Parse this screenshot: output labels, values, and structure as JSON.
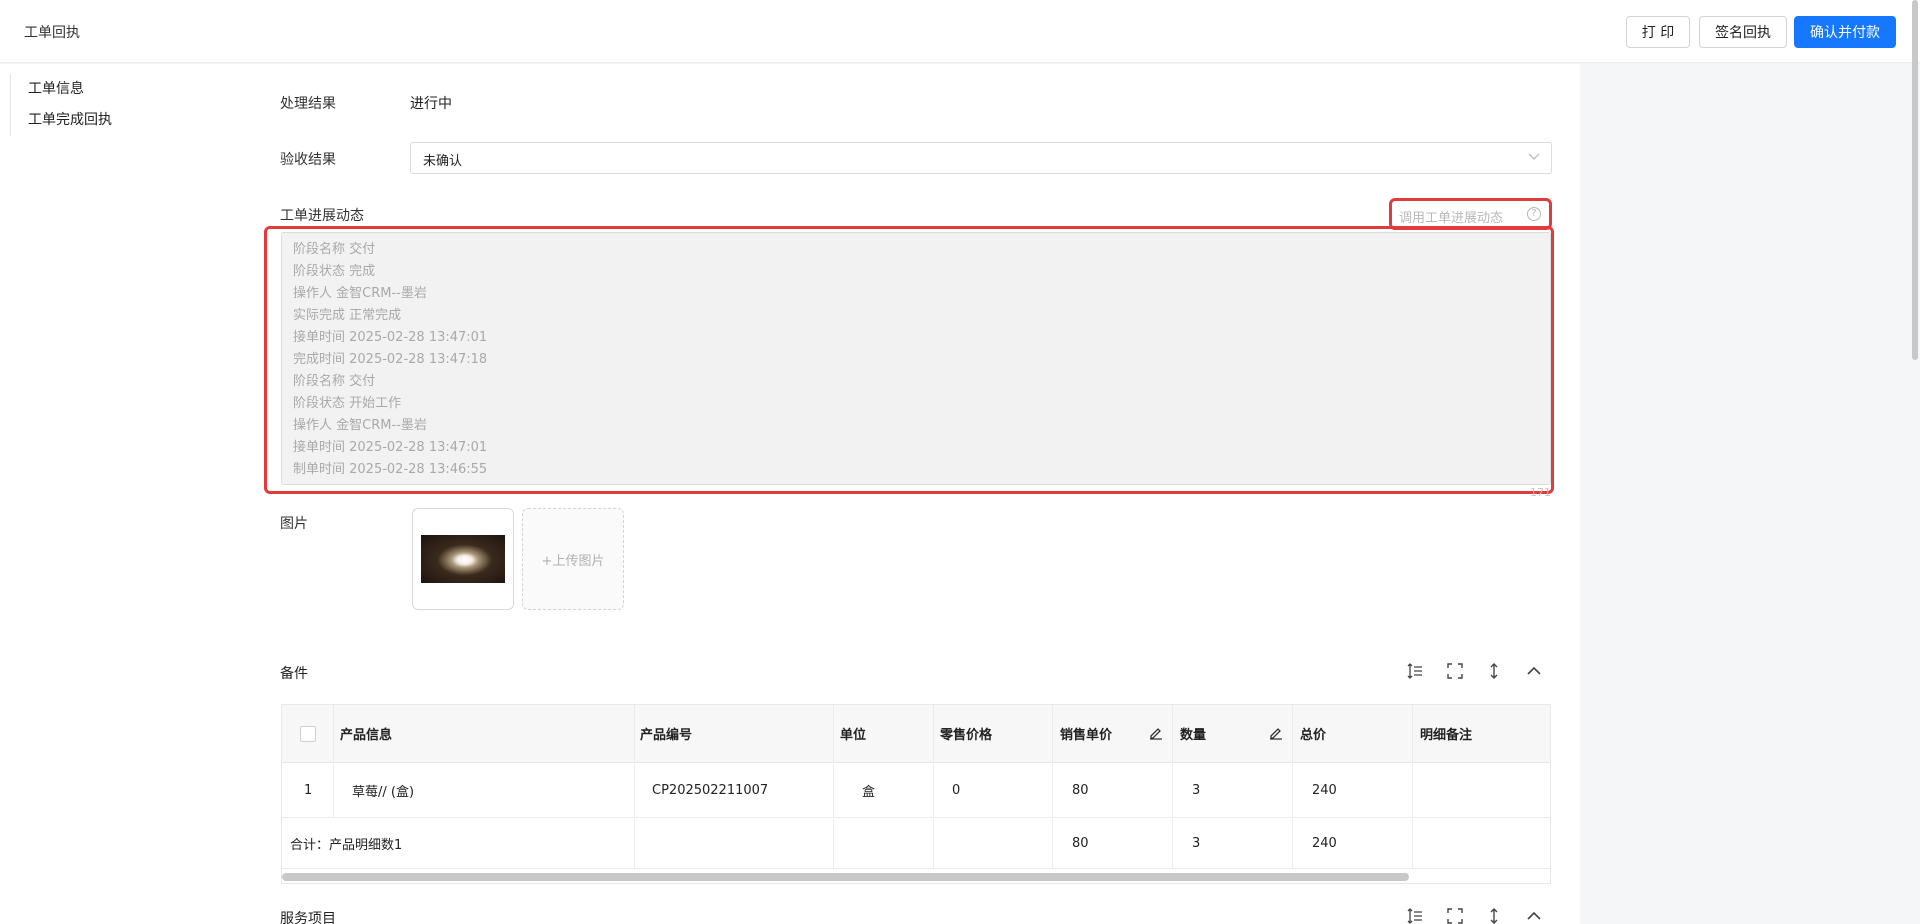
{
  "header": {
    "title": "工单回执",
    "buttons": {
      "print": "打 印",
      "sign_receipt": "签名回执",
      "confirm_pay": "确认并付款"
    }
  },
  "sidebar": {
    "items": [
      {
        "label": "工单信息"
      },
      {
        "label": "工单完成回执"
      }
    ]
  },
  "form": {
    "result_label": "处理结果",
    "result_value": "进行中",
    "acceptance_label": "验收结果",
    "acceptance_value": "未确认",
    "progress_label": "工单进展动态",
    "apply_progress_placeholder": "调用工单进展动态",
    "progress_lines": [
      "阶段名称 交付",
      "阶段状态 完成",
      "操作人 金智CRM--墨岩",
      "实际完成 正常完成",
      "接单时间 2025-02-28 13:47:01",
      "完成时间 2025-02-28 13:47:18",
      "阶段名称 交付",
      "阶段状态 开始工作",
      "操作人 金智CRM--墨岩",
      "接单时间 2025-02-28 13:47:01",
      "制单时间 2025-02-28 13:46:55"
    ],
    "char_count": "171",
    "images_label": "图片",
    "upload_label": "+上传图片"
  },
  "parts": {
    "title": "备件",
    "columns": [
      "产品信息",
      "产品编号",
      "单位",
      "零售价格",
      "销售单价",
      "数量",
      "总价",
      "明细备注"
    ],
    "rows": [
      {
        "index": "1",
        "product": "草莓// (盒)",
        "code": "CP202502211007",
        "unit": "盒",
        "retail": "0",
        "price": "80",
        "qty": "3",
        "total": "240",
        "note": ""
      }
    ],
    "summary": {
      "label": "合计：产品明细数1",
      "price": "80",
      "qty": "3",
      "total": "240"
    }
  },
  "service": {
    "title": "服务项目"
  },
  "colors": {
    "primary": "#1677ff",
    "highlight": "#e23b3b"
  }
}
